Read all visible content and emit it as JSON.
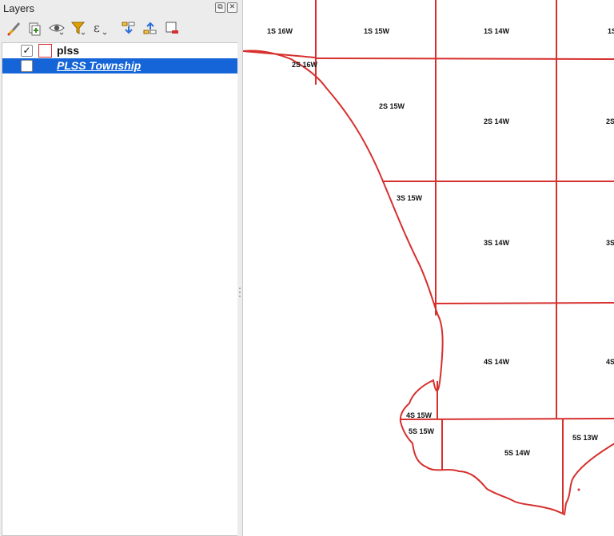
{
  "panel": {
    "title": "Layers",
    "float_icon": "⧉",
    "close_icon": "✕",
    "toolbar": [
      {
        "name": "style-manager-icon"
      },
      {
        "name": "add-group-icon"
      },
      {
        "name": "visibility-icon"
      },
      {
        "name": "filter-legend-icon"
      },
      {
        "name": "filter-expression-icon"
      },
      {
        "name": "expand-all-icon"
      },
      {
        "name": "collapse-all-icon"
      },
      {
        "name": "remove-layer-icon"
      }
    ]
  },
  "layers": [
    {
      "label": "plss",
      "checked": true,
      "check_glyph": "✓",
      "swatch_color": "#d6302d"
    },
    {
      "label": "PLSS Township",
      "checked": false,
      "selected": true
    }
  ],
  "colors": {
    "selection": "#1565d8",
    "township_outline": "#d6302d"
  },
  "map": {
    "townships": [
      {
        "label": "1S 16W"
      },
      {
        "label": "1S 15W"
      },
      {
        "label": "1S 14W"
      },
      {
        "label": "1S"
      },
      {
        "label": "2S 16W"
      },
      {
        "label": "2S 15W"
      },
      {
        "label": "2S 14W"
      },
      {
        "label": "2S"
      },
      {
        "label": "3S 15W"
      },
      {
        "label": "3S 14W"
      },
      {
        "label": "3S"
      },
      {
        "label": "4S 14W"
      },
      {
        "label": "4S"
      },
      {
        "label": "4S 15W"
      },
      {
        "label": "5S 15W"
      },
      {
        "label": "5S 14W"
      },
      {
        "label": "5S 13W"
      }
    ]
  }
}
